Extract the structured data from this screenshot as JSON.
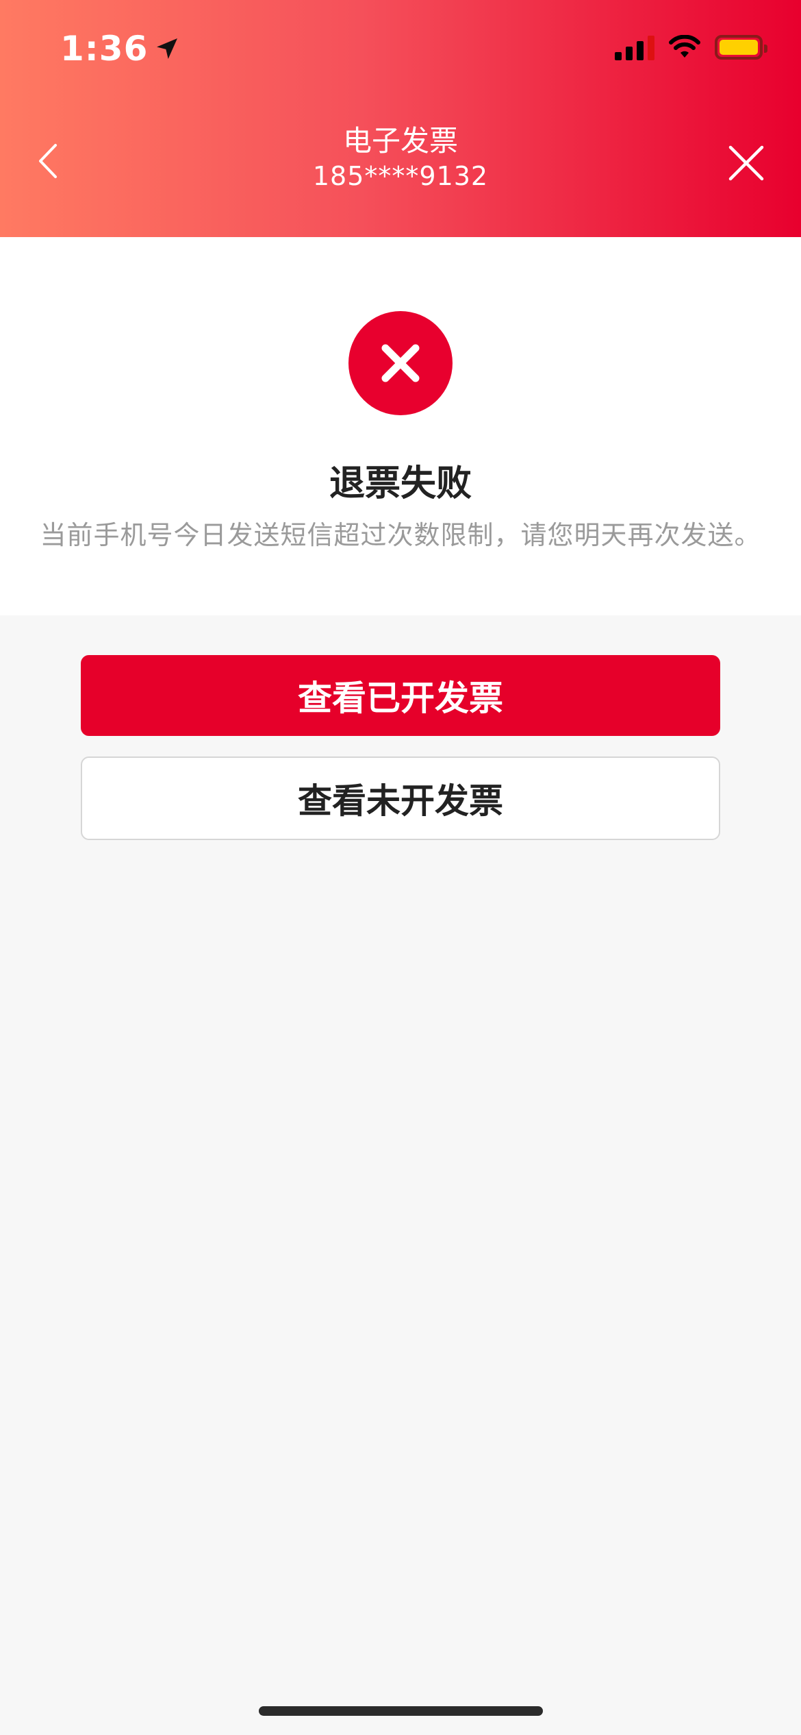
{
  "status_bar": {
    "time": "1:36",
    "location_icon": "location-arrow-icon",
    "signal_icon": "cellular-signal-icon",
    "wifi_icon": "wifi-icon",
    "battery_icon": "battery-icon",
    "battery_color": "#ffd000"
  },
  "nav": {
    "title": "电子发票",
    "subtitle": "185****9132",
    "back_icon": "chevron-left-icon",
    "close_icon": "close-icon",
    "gradient_start": "#ff7a62",
    "gradient_end": "#e8002e"
  },
  "result": {
    "icon": "error-x-icon",
    "icon_color": "#e8002e",
    "title": "退票失败",
    "message": "当前手机号今日发送短信超过次数限制，请您明天再次发送。"
  },
  "actions": {
    "view_issued_label": "查看已开发票",
    "view_unissued_label": "查看未开发票",
    "primary_color": "#e6002a"
  }
}
